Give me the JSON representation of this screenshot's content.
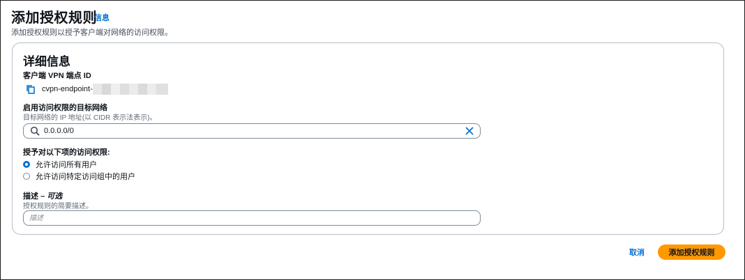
{
  "header": {
    "title": "添加授权规则",
    "info_link": "信息",
    "description": "添加授权规则以授予客户端对网络的访问权限。"
  },
  "details": {
    "title": "详细信息",
    "endpoint": {
      "label": "客户端 VPN 端点 ID",
      "value": "cvpn-endpoint-"
    },
    "network": {
      "label": "启用访问权限的目标网络",
      "hint": "目标网络的 IP 地址(以 CIDR 表示法表示)。",
      "value": "0.0.0.0/0"
    },
    "grant": {
      "label": "授予对以下项的访问权限:",
      "options": [
        {
          "label": "允许访问所有用户",
          "selected": true
        },
        {
          "label": "允许访问特定访问组中的用户",
          "selected": false
        }
      ]
    },
    "description_field": {
      "label_main": "描述",
      "label_optional": "可选",
      "hint": "授权规则的简要描述。",
      "placeholder": "描述"
    }
  },
  "actions": {
    "cancel": "取消",
    "submit": "添加授权规则"
  },
  "colors": {
    "accent": "#0972d3",
    "primary_button": "#ff9900"
  }
}
